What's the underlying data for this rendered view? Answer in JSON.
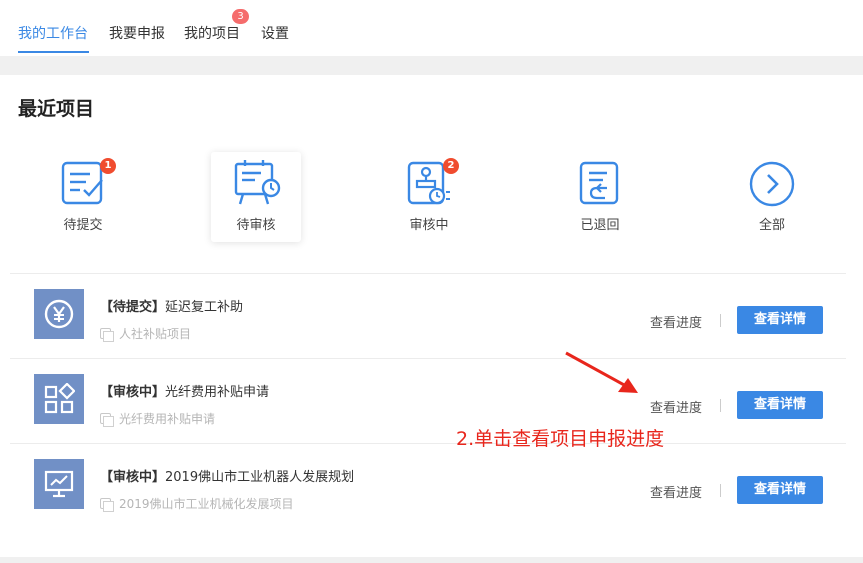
{
  "tabs": [
    {
      "label": "我的工作台",
      "active": true
    },
    {
      "label": "我要申报"
    },
    {
      "label": "我的项目",
      "badge": "3"
    },
    {
      "label": "设置"
    }
  ],
  "section_title": "最近项目",
  "categories": [
    {
      "label": "待提交",
      "icon": "submit-pending-icon",
      "badge": "1"
    },
    {
      "label": "待审核",
      "icon": "review-pending-icon",
      "selected": true
    },
    {
      "label": "审核中",
      "icon": "reviewing-icon",
      "badge": "2"
    },
    {
      "label": "已退回",
      "icon": "returned-icon"
    },
    {
      "label": "全部",
      "icon": "chevron-right-circle-icon"
    }
  ],
  "projects": [
    {
      "status": "【待提交】",
      "name": "延迟复工补助",
      "category": "人社补贴项目",
      "icon": "yen-icon"
    },
    {
      "status": "【审核中】",
      "name": "光纤费用补贴申请",
      "category": "光纤费用补贴申请",
      "icon": "apps-grid-icon"
    },
    {
      "status": "【审核中】",
      "name": "2019佛山市工业机器人发展规划",
      "category": "2019佛山市工业机械化发展项目",
      "icon": "presentation-icon"
    }
  ],
  "actions": {
    "progress_label": "查看进度",
    "detail_label": "查看详情"
  },
  "annotation": "2.单击查看项目申报进度",
  "colors": {
    "accent": "#3a88e4",
    "thumb": "#7190c6",
    "badge": "#f04c2f",
    "annotation": "#e8261c"
  }
}
